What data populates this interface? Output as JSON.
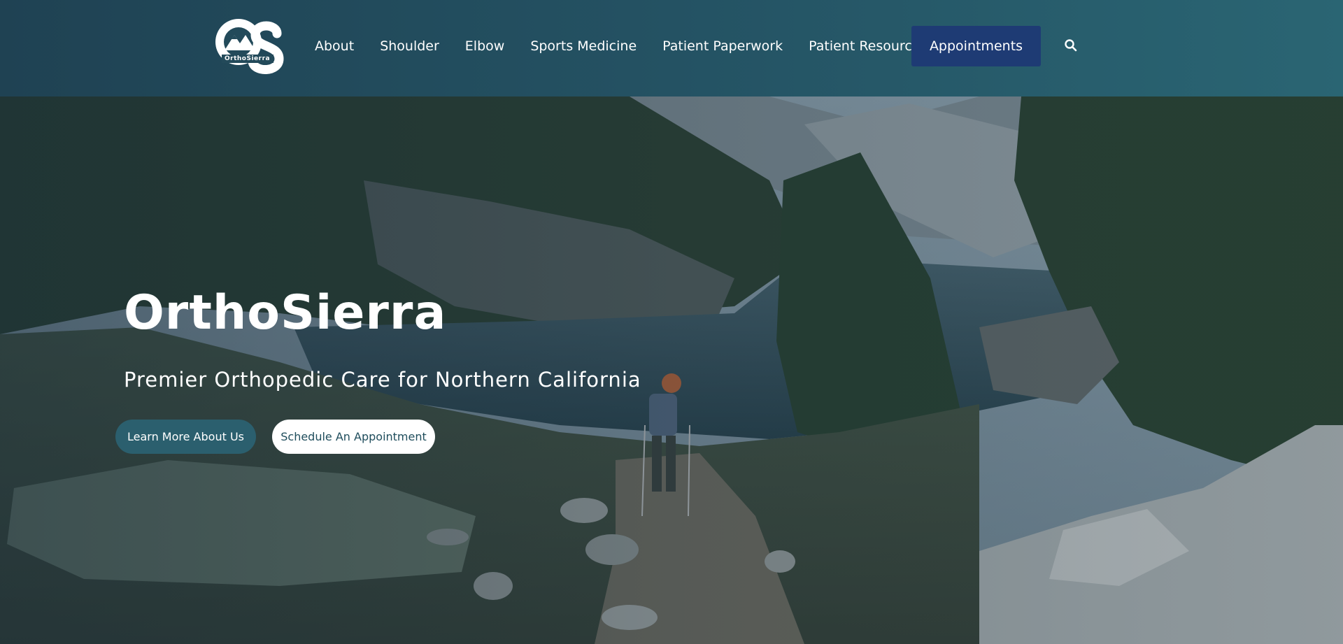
{
  "brand": {
    "logo_letters": "OS",
    "logo_wordmark": "OrthoSierra"
  },
  "nav": {
    "items": [
      {
        "label": "About"
      },
      {
        "label": "Shoulder"
      },
      {
        "label": "Elbow"
      },
      {
        "label": "Sports Medicine"
      },
      {
        "label": "Patient Paperwork"
      },
      {
        "label": "Patient Resources"
      }
    ],
    "appointments_label": "Appointments",
    "search_icon": "search-icon"
  },
  "hero": {
    "title": "OrthoSierra",
    "subtitle": "Premier Orthopedic Care for Northern California",
    "learn_button": "Learn More About Us",
    "schedule_button": "Schedule An Appointment"
  },
  "colors": {
    "header_bg": "#245263",
    "appointments_bg": "#1e3b74",
    "learn_button_bg": "#2b5f6e",
    "schedule_button_bg": "#ffffff"
  }
}
